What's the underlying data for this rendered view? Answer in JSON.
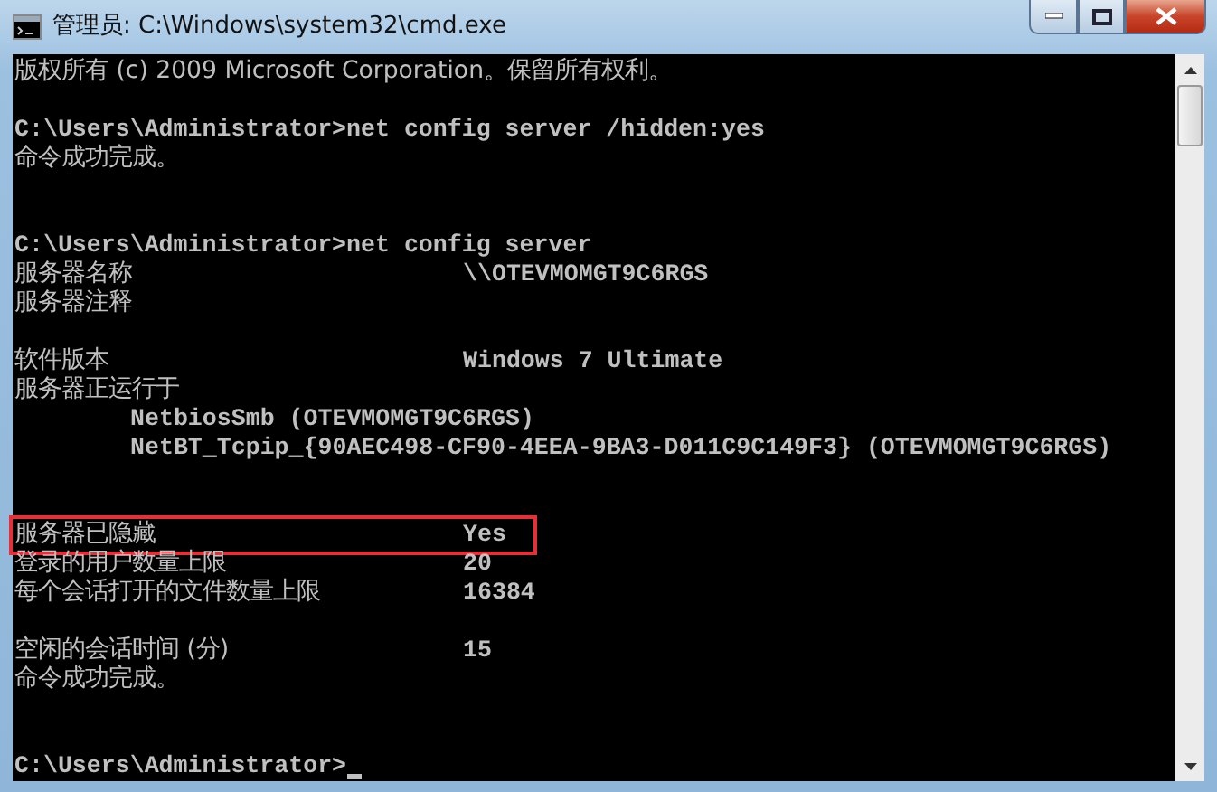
{
  "window": {
    "title": "管理员: C:\\Windows\\system32\\cmd.exe"
  },
  "console_lines": [
    {
      "kind": "text",
      "text": "版权所有 (c) 2009 Microsoft Corporation。保留所有权利。"
    },
    {
      "kind": "blank"
    },
    {
      "kind": "text",
      "text": "C:\\Users\\Administrator>net config server /hidden:yes"
    },
    {
      "kind": "text",
      "text": "命令成功完成。"
    },
    {
      "kind": "blank"
    },
    {
      "kind": "blank"
    },
    {
      "kind": "text",
      "text": "C:\\Users\\Administrator>net config server"
    },
    {
      "kind": "pair",
      "label": "服务器名称",
      "value": "\\\\OTEVMOMGT9C6RGS",
      "highlighted": false
    },
    {
      "kind": "text",
      "text": "服务器注释"
    },
    {
      "kind": "blank"
    },
    {
      "kind": "pair",
      "label": "软件版本",
      "value": "Windows 7 Ultimate",
      "highlighted": false
    },
    {
      "kind": "text",
      "text": "服务器正运行于"
    },
    {
      "kind": "indent",
      "text": "NetbiosSmb (OTEVMOMGT9C6RGS)"
    },
    {
      "kind": "indent",
      "text": "NetBT_Tcpip_{90AEC498-CF90-4EEA-9BA3-D011C9C149F3} (OTEVMOMGT9C6RGS)"
    },
    {
      "kind": "blank"
    },
    {
      "kind": "blank"
    },
    {
      "kind": "pair",
      "label": "服务器已隐藏",
      "value": "Yes",
      "highlighted": true
    },
    {
      "kind": "pair",
      "label": "登录的用户数量上限",
      "value": "20",
      "highlighted": false
    },
    {
      "kind": "pair",
      "label": "每个会话打开的文件数量上限",
      "value": "16384",
      "highlighted": false
    },
    {
      "kind": "blank"
    },
    {
      "kind": "pair",
      "label": "空闲的会话时间 (分)",
      "value": "15",
      "highlighted": false
    },
    {
      "kind": "text",
      "text": "命令成功完成。"
    },
    {
      "kind": "blank"
    },
    {
      "kind": "blank"
    },
    {
      "kind": "prompt",
      "text": "C:\\Users\\Administrator>"
    }
  ]
}
